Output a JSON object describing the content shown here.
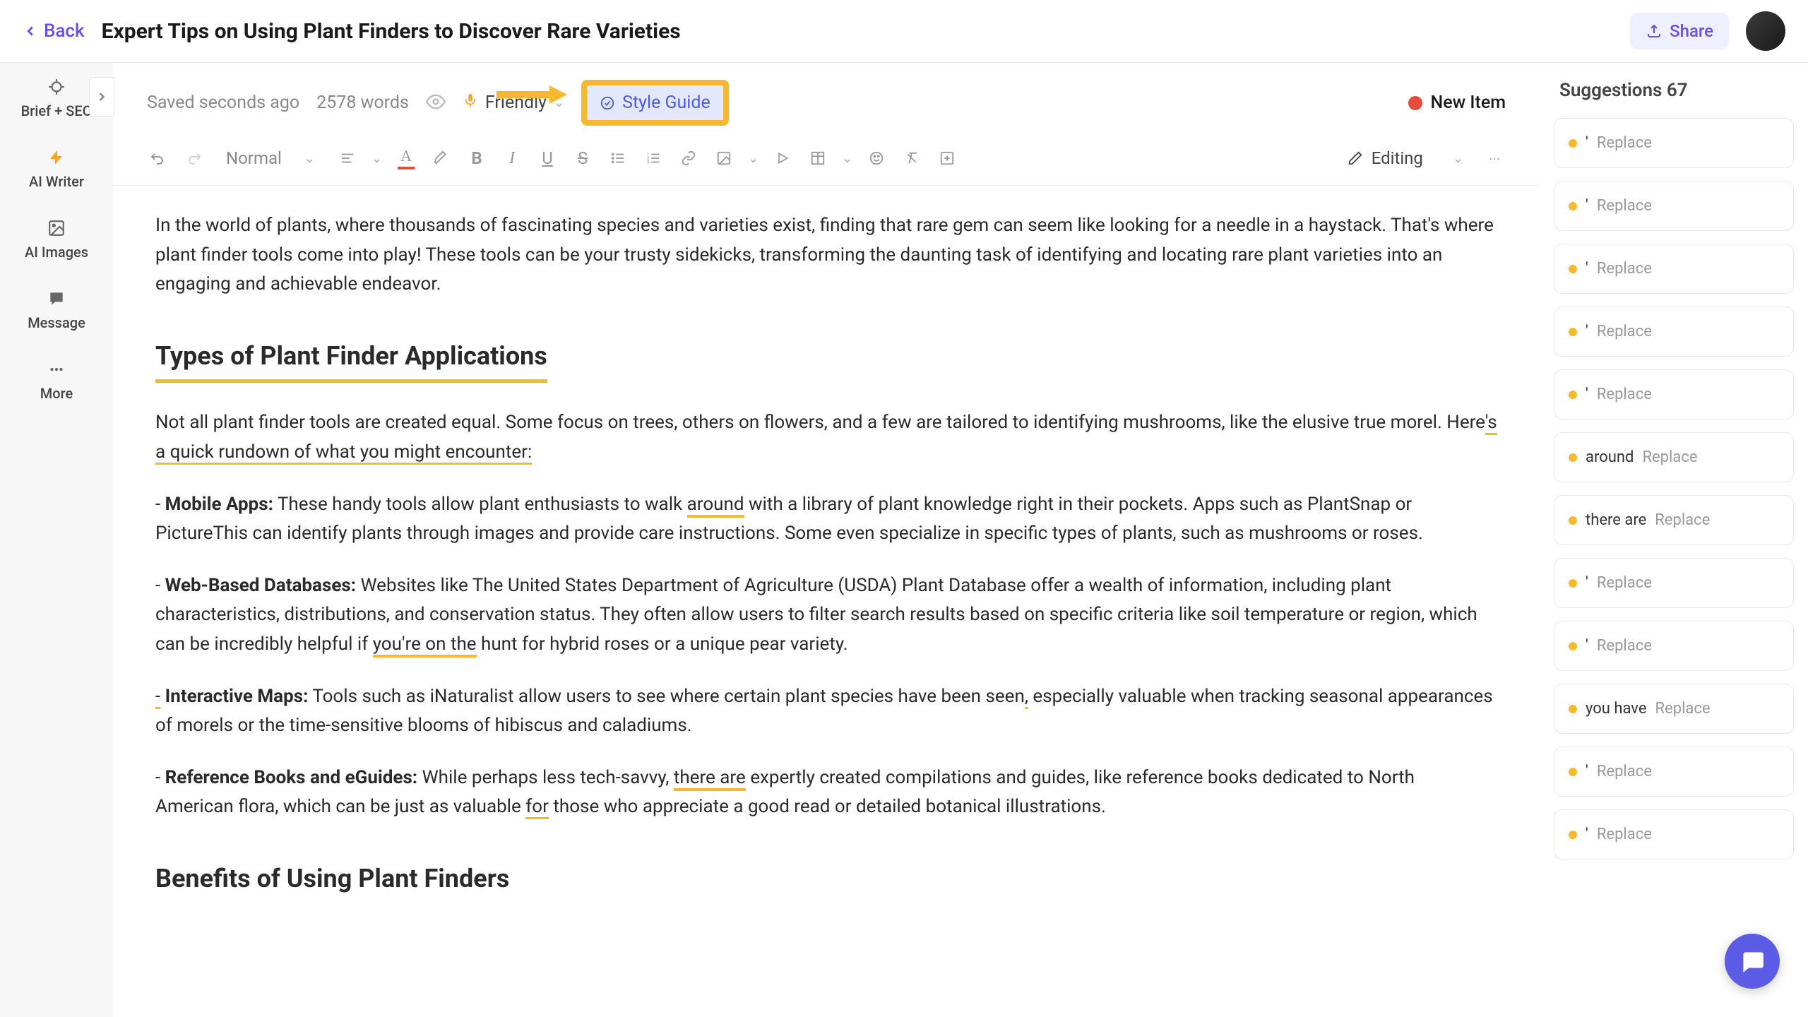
{
  "header": {
    "back": "Back",
    "title": "Expert Tips on Using Plant Finders to Discover Rare Varieties",
    "share": "Share"
  },
  "sidebar": {
    "items": [
      {
        "label": "Brief + SEO"
      },
      {
        "label": "AI Writer"
      },
      {
        "label": "AI Images"
      },
      {
        "label": "Message"
      },
      {
        "label": "More"
      }
    ]
  },
  "statusBar": {
    "saved": "Saved seconds ago",
    "wordCount": "2578 words",
    "tone": "Friendly",
    "styleGuide": "Style Guide",
    "newItem": "New Item"
  },
  "toolbar": {
    "paragraphStyle": "Normal",
    "mode": "Editing"
  },
  "content": {
    "p1": "In the world of plants, where thousands of fascinating species and varieties exist, finding that rare gem can seem like looking for a needle in a haystack. That's where plant finder tools come into play! These tools can be your trusty sidekicks, transforming the daunting task of identifying and locating rare plant varieties into an engaging and achievable endeavor.",
    "h1": "Types of Plant Finder Applications",
    "p2a": "Not all plant finder tools are created equal. Some focus on trees, others on flowers, and a few are tailored to identifying mushrooms, like the elusive true morel. Here",
    "p2b": "'s a quick rundown of what you might encounter:",
    "p3_label": "Mobile Apps:",
    "p3a": " These handy tools allow plant enthusiasts to walk ",
    "p3_hi": "around",
    "p3b": " with a library of plant knowledge right in their pockets. Apps such as PlantSnap or PictureThis can identify plants through images and provide care instructions. Some even specialize in specific types of plants, such as mushrooms or roses.",
    "p4_label": "Web-Based Databases:",
    "p4a": " Websites like The United States Department of Agriculture (USDA) Plant Database offer a wealth of information, including plant characteristics, distributions, and conservation status. They often allow users to filter search results based on specific criteria like soil temperature or region, which can be incredibly helpful if ",
    "p4_hi": "you're on the",
    "p4b": " hunt for hybrid roses or a unique pear variety.",
    "p5_pre": "-",
    "p5_label": " Interactive Maps:",
    "p5a": " Tools such as iNaturalist allow users to see where certain plant species have been seen",
    "p5_hi": ",",
    "p5b": " especially valuable when tracking seasonal appearances of morels or the time-sensitive blooms of hibiscus and caladiums.",
    "p6_label": "Reference Books and eGuides:",
    "p6a": " While perhaps less tech-savvy, ",
    "p6_hi": "there are",
    "p6b": " expertly created compilations and guides, like reference books dedicated to North American flora, which can be just as valuable ",
    "p6_hi2": "for",
    "p6c": " those who appreciate a good read or detailed botanical illustrations.",
    "h2": "Benefits of Using Plant Finders"
  },
  "suggestions": {
    "title": "Suggestions 67",
    "items": [
      {
        "word": "'",
        "action": "Replace"
      },
      {
        "word": "'",
        "action": "Replace"
      },
      {
        "word": "'",
        "action": "Replace"
      },
      {
        "word": "'",
        "action": "Replace"
      },
      {
        "word": "'",
        "action": "Replace"
      },
      {
        "word": "around",
        "action": "Replace"
      },
      {
        "word": "there are",
        "action": "Replace"
      },
      {
        "word": "'",
        "action": "Replace"
      },
      {
        "word": "'",
        "action": "Replace"
      },
      {
        "word": "you have",
        "action": "Replace"
      },
      {
        "word": "'",
        "action": "Replace"
      },
      {
        "word": "'",
        "action": "Replace"
      }
    ]
  }
}
